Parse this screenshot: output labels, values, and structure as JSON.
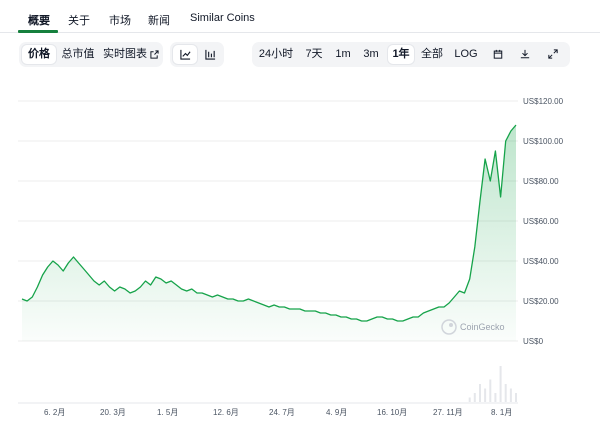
{
  "nav": {
    "tabs": [
      {
        "label": "概要",
        "active": true
      },
      {
        "label": "关于",
        "active": false
      },
      {
        "label": "市场",
        "active": false
      },
      {
        "label": "新闻",
        "active": false
      },
      {
        "label": "Similar Coins",
        "active": false
      }
    ]
  },
  "toolbar": {
    "view_buttons": [
      {
        "label": "价格",
        "active": true
      },
      {
        "label": "总市值",
        "active": false
      },
      {
        "label": "实时图表",
        "active": false,
        "icon": "external-link-icon"
      }
    ],
    "chart_type_buttons": [
      {
        "icon": "line-chart-icon",
        "active": true
      },
      {
        "icon": "candlestick-chart-icon",
        "active": false
      }
    ],
    "range_buttons": [
      {
        "label": "24小时",
        "active": false
      },
      {
        "label": "7天",
        "active": false
      },
      {
        "label": "1m",
        "active": false
      },
      {
        "label": "3m",
        "active": false
      },
      {
        "label": "1年",
        "active": true
      },
      {
        "label": "全部",
        "active": false
      },
      {
        "label": "LOG",
        "active": false
      }
    ],
    "tool_icons": [
      "calendar-icon",
      "download-icon",
      "expand-icon"
    ]
  },
  "chart_data": {
    "type": "area",
    "x_labels": [
      "6. 2月",
      "20. 3月",
      "1. 5月",
      "12. 6月",
      "24. 7月",
      "4. 9月",
      "16. 10月",
      "27. 11月",
      "8. 1月"
    ],
    "y_ticks": [
      "US$120.00",
      "US$100.00",
      "US$80.00",
      "US$60.00",
      "US$40.00",
      "US$20.00",
      "US$0"
    ],
    "ylim": [
      0,
      120
    ],
    "series": [
      {
        "values": [
          21,
          20,
          22,
          27,
          33,
          37,
          40,
          38,
          35,
          39,
          42,
          39,
          36,
          33,
          30,
          28,
          30,
          27,
          25,
          27,
          26,
          24,
          25,
          27,
          30,
          28,
          32,
          31,
          29,
          30,
          28,
          26,
          25,
          26,
          24,
          24,
          23,
          22,
          23,
          22,
          21,
          21,
          20,
          20,
          21,
          20,
          19,
          18,
          17,
          18,
          17,
          17,
          16,
          16,
          16,
          15,
          15,
          15,
          14,
          14,
          13,
          13,
          12,
          12,
          11,
          11,
          10,
          10,
          11,
          12,
          12,
          11,
          11,
          10,
          10,
          11,
          12,
          12,
          14,
          15,
          16,
          17,
          17,
          19,
          22,
          25,
          24,
          31,
          47,
          70,
          91,
          80,
          95,
          72,
          100,
          105,
          108
        ]
      }
    ],
    "volume": [
      0,
      0,
      0,
      0,
      0,
      0,
      0,
      0,
      0,
      0,
      0,
      0,
      0,
      0,
      0,
      0,
      0,
      0,
      0,
      0,
      0,
      0,
      0,
      0,
      0,
      0,
      0,
      0,
      0,
      0,
      0,
      0,
      0,
      0,
      0,
      0,
      0,
      0,
      0,
      0,
      0,
      0,
      0,
      0,
      0,
      0,
      0,
      0,
      0,
      0,
      0,
      0,
      0,
      0,
      0,
      0,
      0,
      0,
      0,
      0,
      0,
      0,
      0,
      0,
      0,
      0,
      0,
      0,
      0,
      0,
      0,
      0,
      0,
      0,
      0,
      0,
      0,
      0,
      0,
      0,
      0,
      0,
      0,
      0,
      0,
      0,
      0,
      1,
      2,
      4,
      3,
      5,
      2,
      8,
      4,
      3,
      2
    ],
    "watermark": "CoinGecko",
    "grid": true,
    "line_color": "#16a34a",
    "fill_color": "#16a34a"
  }
}
